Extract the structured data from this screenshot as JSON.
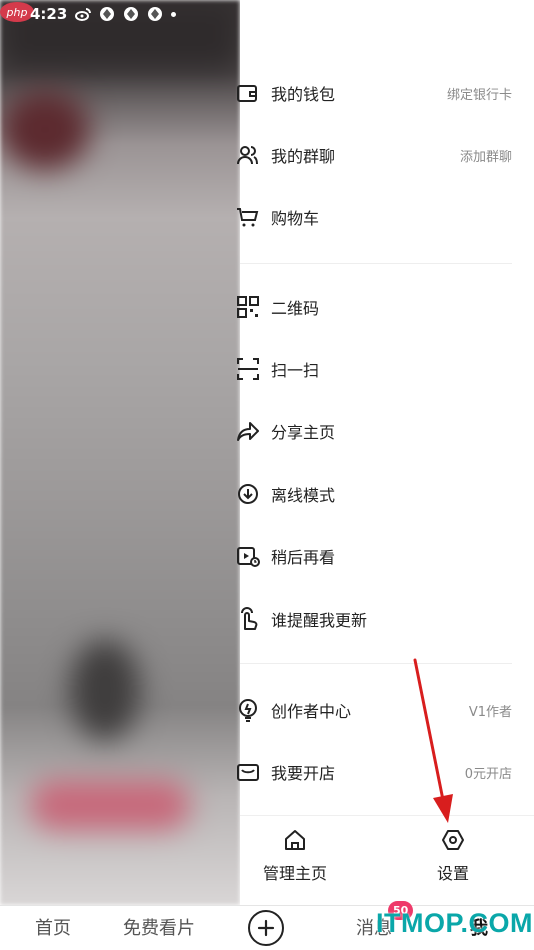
{
  "status_bar": {
    "time": "4:23"
  },
  "site_logo": "php",
  "menu": {
    "items": [
      {
        "icon": "wallet-icon",
        "label": "我的钱包",
        "extra": "绑定银行卡"
      },
      {
        "icon": "group-chat-icon",
        "label": "我的群聊",
        "extra": "添加群聊"
      },
      {
        "icon": "cart-icon",
        "label": "购物车",
        "extra": ""
      },
      {
        "icon": "qrcode-icon",
        "label": "二维码",
        "extra": ""
      },
      {
        "icon": "scan-icon",
        "label": "扫一扫",
        "extra": ""
      },
      {
        "icon": "share-icon",
        "label": "分享主页",
        "extra": ""
      },
      {
        "icon": "offline-download-icon",
        "label": "离线模式",
        "extra": ""
      },
      {
        "icon": "watch-later-icon",
        "label": "稍后再看",
        "extra": ""
      },
      {
        "icon": "remind-update-icon",
        "label": "谁提醒我更新",
        "extra": ""
      },
      {
        "icon": "creator-bulb-icon",
        "label": "创作者中心",
        "extra": "V1作者"
      },
      {
        "icon": "open-shop-icon",
        "label": "我要开店",
        "extra": "0元开店"
      }
    ]
  },
  "drawer_bottom": {
    "manage_home": "管理主页",
    "settings": "设置"
  },
  "tab_bar": {
    "home": "首页",
    "free": "免费看片",
    "messages": "消息",
    "messages_badge": "50",
    "me": "我"
  },
  "watermark": "ITMOP.COM",
  "colors": {
    "accent_badge": "#ee3a6a",
    "annotation_arrow": "#d81e1e",
    "watermark": "#0aa7a9"
  }
}
